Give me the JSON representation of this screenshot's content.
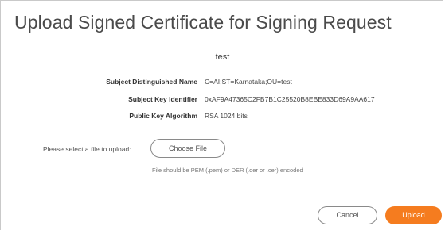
{
  "dialog": {
    "title": "Upload Signed Certificate for Signing Request",
    "certificate_name": "test"
  },
  "details": [
    {
      "label": "Subject Distinguished Name",
      "value": "C=AI;ST=Karnataka;OU=test"
    },
    {
      "label": "Subject Key Identifier",
      "value": "0xAF9A47365C2FB7B1C25520B8EBE833D69A9AA617"
    },
    {
      "label": "Public Key Algorithm",
      "value": "RSA 1024 bits"
    }
  ],
  "upload": {
    "label": "Please select a file to upload:",
    "choose_file_label": "Choose File",
    "hint": "File should be PEM (.pem) or DER (.der or .cer) encoded"
  },
  "actions": {
    "cancel_label": "Cancel",
    "upload_label": "Upload"
  },
  "colors": {
    "accent": "#f57c1f",
    "title_text": "#4a4a4a",
    "border": "#c9c9c9"
  }
}
